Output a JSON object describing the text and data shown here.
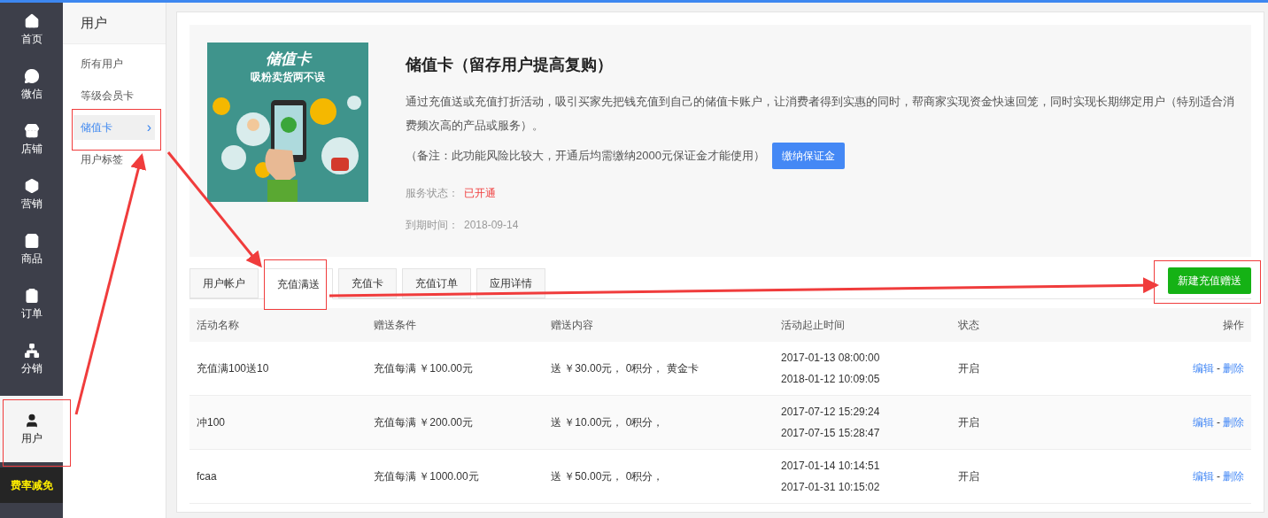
{
  "nav": [
    {
      "label": "首页",
      "selected": false
    },
    {
      "label": "微信",
      "selected": false
    },
    {
      "label": "店铺",
      "selected": false
    },
    {
      "label": "营销",
      "selected": false
    },
    {
      "label": "商品",
      "selected": false
    },
    {
      "label": "订单",
      "selected": false
    },
    {
      "label": "分销",
      "selected": false
    },
    {
      "label": "用户",
      "selected": true
    }
  ],
  "promo_badge": "费率减免",
  "submenu": {
    "title": "用户",
    "items": [
      {
        "label": "所有用户",
        "selected": false
      },
      {
        "label": "等级会员卡",
        "selected": false
      },
      {
        "label": "储值卡",
        "selected": true,
        "arrow": "›"
      },
      {
        "label": "用户标签",
        "selected": false
      }
    ]
  },
  "info": {
    "banner_title": "储值卡",
    "banner_subtitle": "吸粉卖货两不误",
    "title": "储值卡（留存用户提高复购）",
    "description": "通过充值送或充值打折活动，吸引买家先把钱充值到自己的储值卡账户，让消费者得到实惠的同时，帮商家实现资金快速回笼，同时实现长期绑定用户（特别适合消费频次高的产品或服务）。",
    "note": "（备注：此功能风险比较大，开通后均需缴纳2000元保证金才能使用）",
    "deposit_button": "缴纳保证金",
    "status_label": "服务状态：",
    "status_value": "已开通",
    "expiry_label": "到期时间：",
    "expiry_value": "2018-09-14"
  },
  "tabs": [
    {
      "label": "用户帐户",
      "selected": false
    },
    {
      "label": "充值满送",
      "selected": true
    },
    {
      "label": "充值卡",
      "selected": false
    },
    {
      "label": "充值订单",
      "selected": false
    },
    {
      "label": "应用详情",
      "selected": false
    }
  ],
  "new_button": "新建充值赠送",
  "table": {
    "columns": [
      "活动名称",
      "赠送条件",
      "赠送内容",
      "活动起止时间",
      "状态",
      "操作"
    ],
    "rows": [
      {
        "name": "充值满100送10",
        "condition": "充值每满 ￥100.00元",
        "reward": "送 ￥30.00元， 0积分， 黄金卡",
        "start": "2017-01-13 08:00:00",
        "end": "2018-01-12 10:09:05",
        "status": "开启",
        "edit": "编辑",
        "separator": "-",
        "delete": "删除"
      },
      {
        "name": "冲100",
        "condition": "充值每满 ￥200.00元",
        "reward": "送 ￥10.00元， 0积分，",
        "start": "2017-07-12 15:29:24",
        "end": "2017-07-15 15:28:47",
        "status": "开启",
        "edit": "编辑",
        "separator": "-",
        "delete": "删除"
      },
      {
        "name": "fcaa",
        "condition": "充值每满 ￥1000.00元",
        "reward": "送 ￥50.00元， 0积分，",
        "start": "2017-01-14 10:14:51",
        "end": "2017-01-31 10:15:02",
        "status": "开启",
        "edit": "编辑",
        "separator": "-",
        "delete": "删除"
      }
    ]
  }
}
